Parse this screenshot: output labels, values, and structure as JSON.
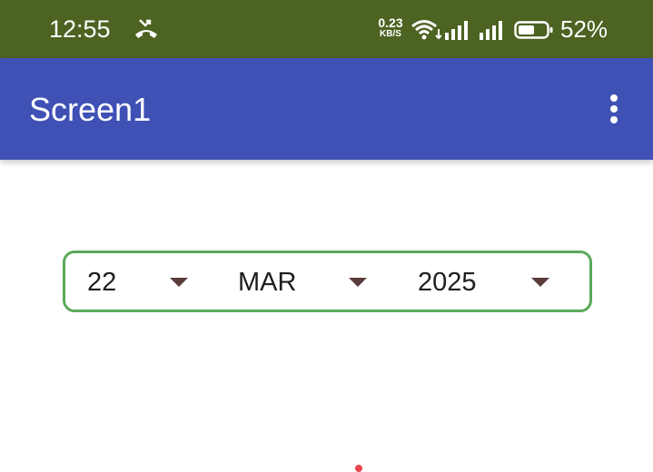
{
  "status_bar": {
    "time": "12:55",
    "net_speed_value": "0.23",
    "net_speed_unit": "KB/S",
    "battery_percent": "52%",
    "icons": [
      "missed-call-icon",
      "wifi-icon",
      "signal-icon",
      "signal-icon",
      "battery-icon"
    ],
    "color": "#4d6322"
  },
  "app_bar": {
    "title": "Screen1",
    "menu_icon": "more-vert-icon",
    "color": "#3f51b5"
  },
  "date_picker": {
    "day": "22",
    "month": "MAR",
    "year": "2025",
    "border_color": "#5aaa5a"
  }
}
